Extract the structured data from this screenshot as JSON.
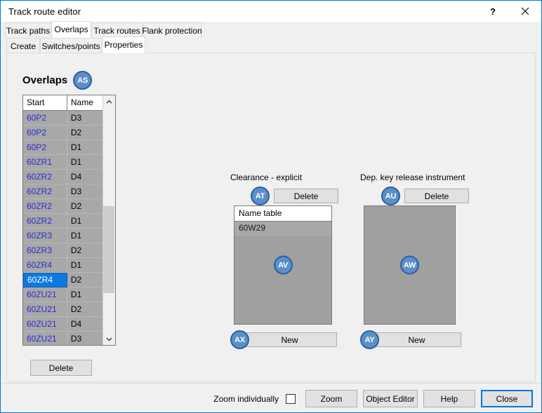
{
  "window": {
    "title": "Track route editor",
    "help_icon": "question-mark-icon",
    "close_icon": "close-x-icon"
  },
  "tabs_primary": [
    {
      "label": "Track paths",
      "active": false
    },
    {
      "label": "Overlaps",
      "active": true
    },
    {
      "label": "Track routes",
      "active": false
    },
    {
      "label": "Flank protection",
      "active": false
    }
  ],
  "tabs_secondary": [
    {
      "label": "Create",
      "active": false
    },
    {
      "label": "Switches/points",
      "active": false
    },
    {
      "label": "Properties",
      "active": true
    }
  ],
  "overlaps": {
    "title": "Overlaps",
    "badge": "AS",
    "columns": [
      "Start",
      "Name"
    ],
    "rows": [
      {
        "start": "60P2",
        "name": "D3",
        "selected": false
      },
      {
        "start": "60P2",
        "name": "D2",
        "selected": false
      },
      {
        "start": "60P2",
        "name": "D1",
        "selected": false
      },
      {
        "start": "60ZR1",
        "name": "D1",
        "selected": false
      },
      {
        "start": "60ZR2",
        "name": "D4",
        "selected": false
      },
      {
        "start": "60ZR2",
        "name": "D3",
        "selected": false
      },
      {
        "start": "60ZR2",
        "name": "D2",
        "selected": false
      },
      {
        "start": "60ZR2",
        "name": "D1",
        "selected": false
      },
      {
        "start": "60ZR3",
        "name": "D1",
        "selected": false
      },
      {
        "start": "60ZR3",
        "name": "D2",
        "selected": false
      },
      {
        "start": "60ZR4",
        "name": "D1",
        "selected": false
      },
      {
        "start": "60ZR4",
        "name": "D2",
        "selected": true
      },
      {
        "start": "60ZU21",
        "name": "D1",
        "selected": false
      },
      {
        "start": "60ZU21",
        "name": "D2",
        "selected": false
      },
      {
        "start": "60ZU21",
        "name": "D4",
        "selected": false
      },
      {
        "start": "60ZU21",
        "name": "D3",
        "selected": false
      }
    ],
    "delete_label": "Delete",
    "scroll_up_icon": "chevron-up-icon",
    "scroll_down_icon": "chevron-down-icon"
  },
  "clearance": {
    "label": "Clearance - explicit",
    "badge_top": "AT",
    "delete_label": "Delete",
    "list_header": "Name table",
    "items": [
      "60W29"
    ],
    "badge_body": "AV",
    "badge_new": "AX",
    "new_label": "New"
  },
  "dep_key": {
    "label": "Dep. key release instrument",
    "badge_top": "AU",
    "delete_label": "Delete",
    "items": [],
    "badge_body": "AW",
    "badge_new": "AY",
    "new_label": "New"
  },
  "bottom": {
    "zoom_individually_label": "Zoom individually",
    "zoom_individually_checked": false,
    "zoom_label": "Zoom",
    "object_editor_label": "Object Editor",
    "help_label": "Help",
    "close_label": "Close"
  },
  "colors": {
    "accent": "#0078d7",
    "badge_fill": "#5b8fc9",
    "badge_border": "#2c5f9e",
    "selection": "#0a7ae0",
    "link_text": "#2b2bd0",
    "panel_gray": "#a0a0a0"
  }
}
